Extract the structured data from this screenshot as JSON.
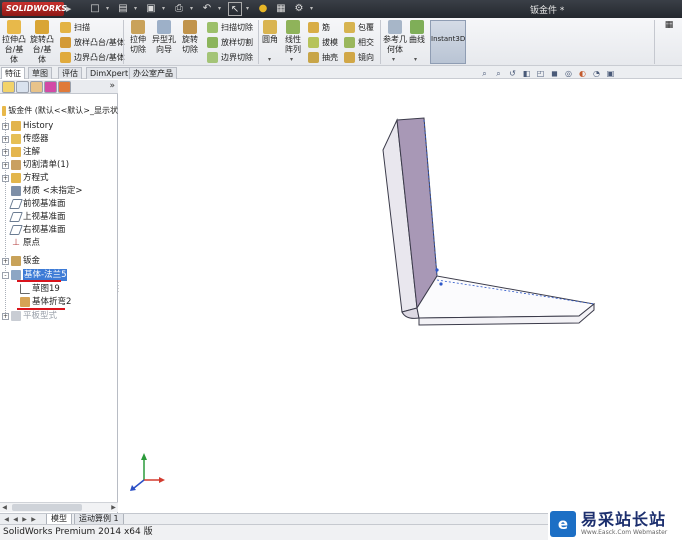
{
  "app": {
    "logo_text": "SOLIDWORKS",
    "document_title": "钣金件 *"
  },
  "quick_access": [
    {
      "icon": "new-document-icon"
    },
    {
      "icon": "open-icon"
    },
    {
      "icon": "save-icon"
    },
    {
      "icon": "print-icon"
    },
    {
      "icon": "undo-icon"
    },
    {
      "icon": "select-icon"
    },
    {
      "icon": "rebuild-icon"
    },
    {
      "icon": "file-properties-icon"
    },
    {
      "icon": "options-icon"
    }
  ],
  "ribbon": {
    "extrude_boss": "拉伸凸台/基体",
    "revolve_boss": "旋转凸台/基体",
    "sweep": "扫描",
    "loft_boss": "放样凸台/基体",
    "boundary_boss": "边界凸台/基体",
    "extrude_cut": "拉伸切除",
    "hole_wizard": "异型孔向导",
    "revolve_cut": "旋转切除",
    "swept_cut": "扫描切除",
    "lofted_cut": "放样切割",
    "boundary_cut": "边界切除",
    "fillet": "圆角",
    "linear_pattern": "线性阵列",
    "rib": "筋",
    "draft": "拔模",
    "shell": "抽壳",
    "wrap": "包覆",
    "intersect": "相交",
    "mirror": "镜向",
    "reference_geometry": "参考几何体",
    "curves": "曲线",
    "instant3d": "Instant3D"
  },
  "command_tabs": [
    "特征",
    "草图",
    "评估",
    "DimXpert",
    "办公室产品"
  ],
  "feature_tree": {
    "root": "钣金件 (默认<<默认>_显示状",
    "items": [
      {
        "label": "History",
        "icon": "history-icon",
        "expand": "+"
      },
      {
        "label": "传感器",
        "icon": "sensor-icon",
        "expand": "+"
      },
      {
        "label": "注解",
        "icon": "annotation-icon",
        "expand": "+"
      },
      {
        "label": "切割清单(1)",
        "icon": "cut-list-icon",
        "expand": "+"
      },
      {
        "label": "方程式",
        "icon": "equation-icon",
        "expand": "+"
      },
      {
        "label": "材质 <未指定>",
        "icon": "material-icon",
        "expand": ""
      },
      {
        "label": "前视基准面",
        "icon": "plane-icon",
        "expand": ""
      },
      {
        "label": "上视基准面",
        "icon": "plane-icon",
        "expand": ""
      },
      {
        "label": "右视基准面",
        "icon": "plane-icon",
        "expand": ""
      },
      {
        "label": "原点",
        "icon": "origin-icon",
        "expand": ""
      },
      {
        "label": "钣金",
        "icon": "sheet-metal-icon",
        "expand": "+"
      },
      {
        "label": "基体-法兰5",
        "icon": "base-flange-icon",
        "expand": "-"
      },
      {
        "label": "草图19",
        "icon": "sketch-icon",
        "expand": ""
      },
      {
        "label": "基体折弯2",
        "icon": "base-bend-icon",
        "expand": ""
      },
      {
        "label": "平板型式",
        "icon": "flat-pattern-icon",
        "expand": "+"
      }
    ]
  },
  "bottom_tabs": [
    "模型",
    "运动算例 1"
  ],
  "status_text": "SolidWorks Premium 2014 x64 版",
  "watermark": {
    "logo": "e",
    "text_cn": "易采站长站",
    "text_en": "Www.Easck.Com Webmaster"
  },
  "colors": {
    "selection": "#3d7bd6",
    "annotation_red": "#d9141c",
    "part_face": "#a898b6",
    "part_edge": "#3b3b4a"
  }
}
